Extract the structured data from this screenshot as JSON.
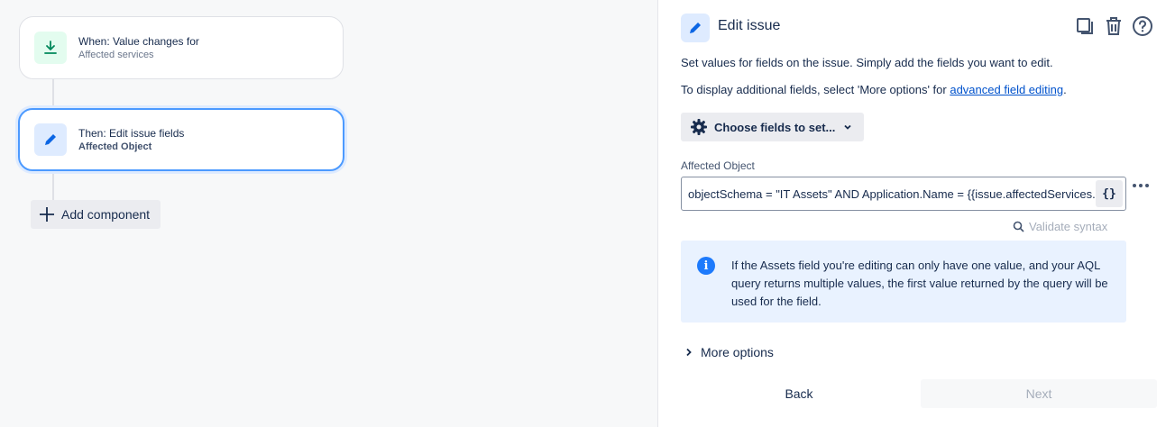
{
  "flow": {
    "trigger": {
      "title": "When: Value changes for",
      "subtitle": "Affected services"
    },
    "action": {
      "title": "Then: Edit issue fields",
      "subtitle": "Affected Object"
    },
    "add_component_label": "Add component"
  },
  "panel": {
    "title": "Edit issue",
    "description": "Set values for fields on the issue. Simply add the fields you want to edit.",
    "additional_prefix": "To display additional fields, select 'More options' for ",
    "additional_link": "advanced field editing",
    "additional_suffix": ".",
    "choose_fields_label": "Choose fields to set...",
    "field": {
      "label": "Affected Object",
      "value": "objectSchema = \"IT Assets\" AND Application.Name = {{issue.affectedServices.name}}",
      "smart_values_label": "{}"
    },
    "validate_label": "Validate syntax",
    "info_text": "If the Assets field you're editing can only have one value, and your AQL query returns multiple values, the first value returned by the query will be used for the field.",
    "more_options_label": "More options",
    "back_label": "Back",
    "next_label": "Next"
  },
  "colors": {
    "accent": "#0052cc",
    "selected_border": "#4c9aff",
    "info_bg": "#e9f2ff",
    "trigger_icon_bg": "#e3fcef"
  },
  "icons": {
    "trigger": "download-arrow-icon",
    "action": "pencil-icon",
    "header_actions": [
      "copy-icon",
      "trash-icon",
      "help-icon"
    ]
  }
}
